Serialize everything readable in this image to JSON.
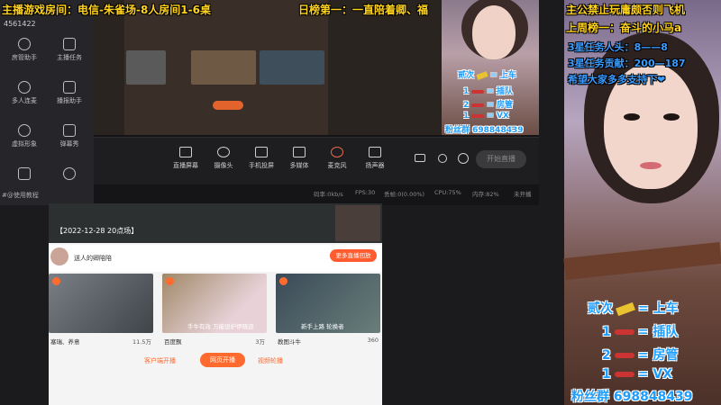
{
  "overlay": {
    "room_title": "主播游戏房间：电信-朱雀场-8人房间1-6桌",
    "rank_text": "日榜第一：一直陪着卿、福",
    "rule_line1": "主公禁止玩庸颇否则飞机",
    "rule_line2": "上周榜一：奋斗的小马a",
    "task_count": "3星任务人头：8——8",
    "task_contrib": "3星任务贡献：200—187",
    "hope_text": "希望大家多多支持下❤",
    "color_yellow": "#ffd21e",
    "color_blue": "#3a9cff"
  },
  "price_list_small": {
    "row1_left": "贰次",
    "row1_right": "= 上车",
    "row2_left": "1",
    "row2_right": "= 插队",
    "row3_left": "2",
    "row3_right": "= 房管",
    "row4_left": "1",
    "row4_right": "= VX",
    "fan_group": "粉丝群 698848439"
  },
  "price_list_big": {
    "row1_left": "贰次",
    "row1_right": "= 上车",
    "row2_left": "1",
    "row2_right": "= 插队",
    "row3_left": "2",
    "row3_right": "= 房管",
    "row4_left": "1",
    "row4_right": "= VX",
    "fan_group": "粉丝群 698848439"
  },
  "sidebar": {
    "user_id": "4561422",
    "items": [
      {
        "label": "房管助手",
        "icon": "people-icon"
      },
      {
        "label": "主播任务",
        "icon": "task-check-icon"
      },
      {
        "label": "多人连麦",
        "icon": "download-icon"
      },
      {
        "label": "播报助手",
        "icon": "star-icon"
      },
      {
        "label": "虚拟形象",
        "icon": "avatar-icon"
      },
      {
        "label": "弹幕秀",
        "icon": "danmaku-icon"
      }
    ],
    "tutorial": "#@使用教程"
  },
  "toolbar": {
    "buttons": [
      {
        "label": "直播屏幕",
        "icon": "screen-icon"
      },
      {
        "label": "摄像头",
        "icon": "camera-icon"
      },
      {
        "label": "手机投屏",
        "icon": "phone-icon"
      },
      {
        "label": "多媒体",
        "icon": "media-icon"
      },
      {
        "label": "麦克风",
        "icon": "mic-icon"
      },
      {
        "label": "扬声器",
        "icon": "speaker-icon"
      }
    ],
    "start_label": "开始直播"
  },
  "statusbar": {
    "speed": "码率:0kb/s",
    "fps": "FPS:30",
    "dropped": "丢帧:0(0.00%)",
    "cpu": "CPU:75%",
    "memory": "内存:82%",
    "record": "未开播"
  },
  "webpage": {
    "banner_title": "【2022-12-28 20点场】",
    "anchor_name": "送人的卿陪陪",
    "more_button": "更多直播回放",
    "cards": [
      {
        "caption": "",
        "name": "塞瑞、养意",
        "views": "11.5万"
      },
      {
        "caption": "手牛有效 万能设护伊晓迩",
        "name": "百度飘",
        "views": "3万"
      },
      {
        "caption": "新手上路 轮换者",
        "name": "教图斗牛",
        "views": "360"
      }
    ],
    "tab_client": "客户端开播",
    "tab_web": "网页开播",
    "tab_video": "视频轮播"
  }
}
